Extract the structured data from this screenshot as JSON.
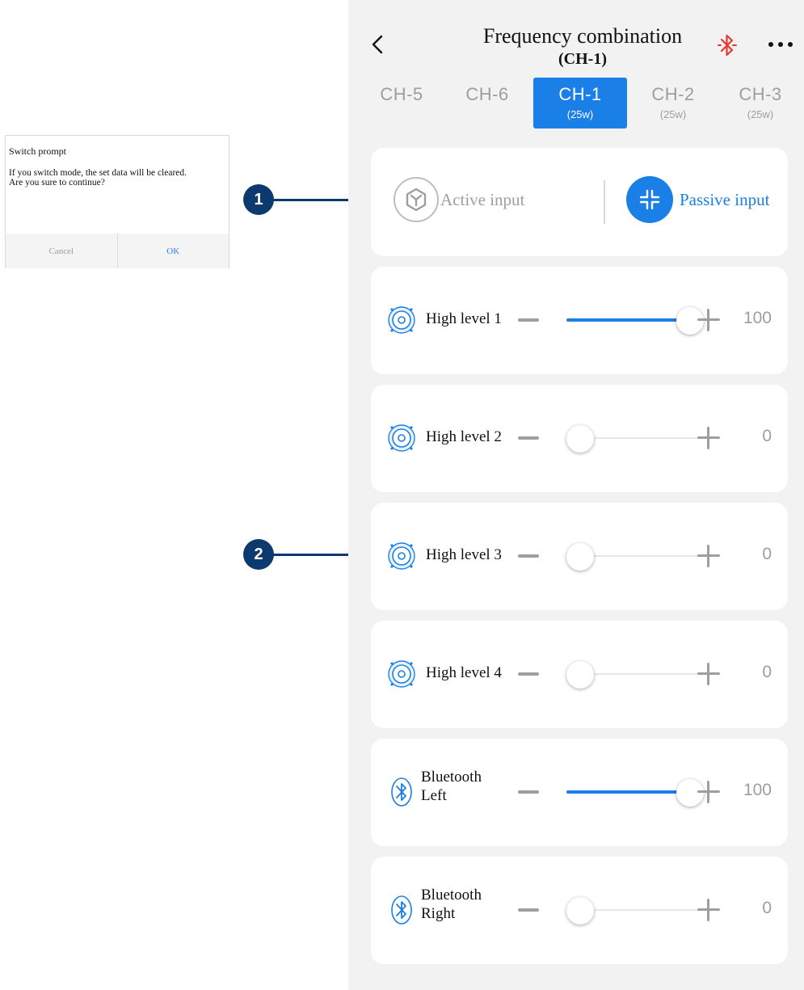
{
  "dialog": {
    "title": "Switch prompt",
    "message_line1": "If you switch mode, the set data will be cleared.",
    "message_line2": "Are you sure to continue?",
    "cancel_label": "Cancel",
    "ok_label": "OK"
  },
  "callouts": [
    "1",
    "2"
  ],
  "header": {
    "title": "Frequency combination",
    "subtitle": "(CH-1)",
    "back_icon": "chevron-left-icon",
    "bluetooth_icon": "bluetooth-disconnected-icon",
    "more_icon": "more-dots-icon"
  },
  "tabs": [
    {
      "label": "CH-5",
      "sub": ""
    },
    {
      "label": "CH-6",
      "sub": ""
    },
    {
      "label": "CH-1",
      "sub": "(25w)",
      "active": true
    },
    {
      "label": "CH-2",
      "sub": "(25w)"
    },
    {
      "label": "CH-3",
      "sub": "(25w)"
    }
  ],
  "input_mode": {
    "active_label": "Active input",
    "passive_label": "Passive input",
    "selected": "passive"
  },
  "channels": [
    {
      "label_line1": "High level 1",
      "label_line2": "",
      "icon": "speaker-icon",
      "value": "100",
      "level": 1.0
    },
    {
      "label_line1": "High level 2",
      "label_line2": "",
      "icon": "speaker-icon",
      "value": "0",
      "level": 0.0
    },
    {
      "label_line1": "High level 3",
      "label_line2": "",
      "icon": "speaker-icon",
      "value": "0",
      "level": 0.0
    },
    {
      "label_line1": "High level 4",
      "label_line2": "",
      "icon": "speaker-icon",
      "value": "0",
      "level": 0.0
    },
    {
      "label_line1": "Bluetooth",
      "label_line2": "Left",
      "icon": "bluetooth-icon",
      "value": "100",
      "level": 1.0
    },
    {
      "label_line1": "Bluetooth",
      "label_line2": "Right",
      "icon": "bluetooth-icon",
      "value": "0",
      "level": 0.0
    }
  ],
  "colors": {
    "accent": "#1a7fe6",
    "callout": "#0d3a6e",
    "muted": "#9e9e9e",
    "bluetooth_disconnected": "#e53935"
  }
}
